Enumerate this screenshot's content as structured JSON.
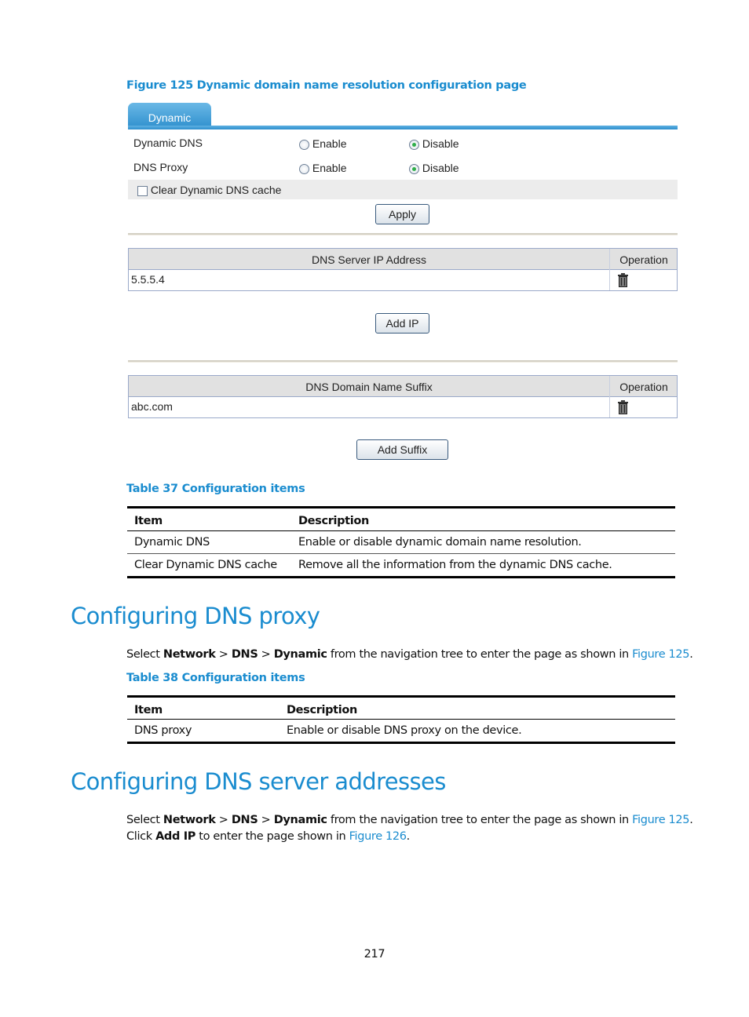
{
  "figure_caption": "Figure 125 Dynamic domain name resolution configuration page",
  "ui": {
    "tab_label": "Dynamic",
    "rows": [
      {
        "label": "Dynamic DNS",
        "options": [
          "Enable",
          "Disable"
        ],
        "selected": "Disable"
      },
      {
        "label": "DNS Proxy",
        "options": [
          "Enable",
          "Disable"
        ],
        "selected": "Disable"
      }
    ],
    "clear_cache": {
      "label": "Clear Dynamic DNS cache",
      "checked": false
    },
    "apply_label": "Apply",
    "ip_table": {
      "headers": [
        "DNS Server IP Address",
        "Operation"
      ],
      "rows": [
        {
          "value": "5.5.5.4",
          "operation_icon": "trash-icon"
        }
      ]
    },
    "add_ip_label": "Add IP",
    "suffix_table": {
      "headers": [
        "DNS Domain Name Suffix",
        "Operation"
      ],
      "rows": [
        {
          "value": "abc.com",
          "operation_icon": "trash-icon"
        }
      ]
    },
    "add_suffix_label": "Add Suffix"
  },
  "table37": {
    "caption": "Table 37 Configuration items",
    "headers": [
      "Item",
      "Description"
    ],
    "rows": [
      [
        "Dynamic DNS",
        "Enable or disable dynamic domain name resolution."
      ],
      [
        "Clear Dynamic DNS cache",
        "Remove all the information from the dynamic DNS cache."
      ]
    ]
  },
  "section_proxy": {
    "heading": "Configuring DNS proxy",
    "para": {
      "t1": "Select ",
      "b1": "Network",
      "t2": " > ",
      "b2": "DNS",
      "t3": " > ",
      "b3": "Dynamic",
      "t4": " from the navigation tree to enter the page as shown in ",
      "link": "Figure 125",
      "t5": "."
    }
  },
  "table38": {
    "caption": "Table 38 Configuration items",
    "headers": [
      "Item",
      "Description"
    ],
    "rows": [
      [
        "DNS proxy",
        "Enable or disable DNS proxy on the device."
      ]
    ]
  },
  "section_server": {
    "heading": "Configuring DNS server addresses",
    "para1": {
      "t1": "Select ",
      "b1": "Network",
      "t2": " > ",
      "b2": "DNS",
      "t3": " > ",
      "b3": "Dynamic",
      "t4": " from the navigation tree to enter the page as shown in ",
      "link": "Figure 125",
      "t5": "."
    },
    "para2": {
      "t1": "Click ",
      "b1": "Add IP",
      "t2": " to enter the page shown in ",
      "link": "Figure 126",
      "t3": "."
    }
  },
  "page_number": "217",
  "colors": {
    "accent": "#1a8ccf",
    "tab": "#2e8fcd",
    "radio_selected": "#2fae4a"
  }
}
